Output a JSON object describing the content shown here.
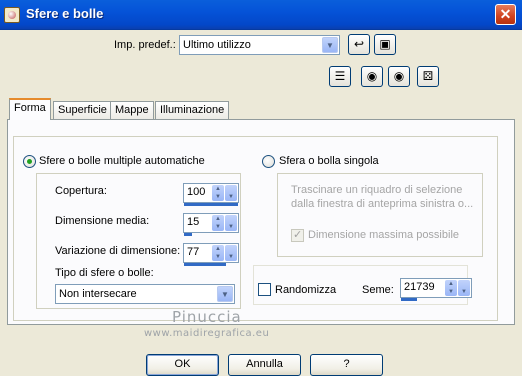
{
  "window": {
    "title": "Sfere e bolle",
    "close_glyph": "✕"
  },
  "preset": {
    "label": "Imp. predef.:",
    "value": "Ultimo utilizzo",
    "icons": [
      "reset-icon",
      "save-preset-icon"
    ]
  },
  "toolbar_icons": [
    "preview-toggle-icon",
    "eye-proof-icon",
    "eye-icon",
    "randomize-dice-icon"
  ],
  "tabs": [
    {
      "label": "Forma",
      "active": true
    },
    {
      "label": "Superficie",
      "active": false
    },
    {
      "label": "Mappe",
      "active": false
    },
    {
      "label": "Illuminazione",
      "active": false
    }
  ],
  "auto": {
    "radio_label": "Sfere o bolle multiple automatiche",
    "selected": true,
    "coverage": {
      "label": "Copertura:",
      "value": "100"
    },
    "avg_size": {
      "label": "Dimensione media:",
      "value": "15"
    },
    "size_var": {
      "label": "Variazione di dimensione:",
      "value": "77"
    },
    "type": {
      "label": "Tipo di sfere o bolle:",
      "value": "Non intersecare"
    }
  },
  "single": {
    "radio_label": "Sfera o bolla singola",
    "selected": false,
    "hint": "Trascinare un riquadro di selezione dalla finestra di anteprima sinistra o...",
    "max_size_label": "Dimensione massima possibile",
    "max_size_checked": true
  },
  "random": {
    "label": "Randomizza",
    "checked": false,
    "seed_label": "Seme:",
    "seed_value": "21739"
  },
  "buttons": {
    "ok": "OK",
    "cancel": "Annulla",
    "help": "?"
  },
  "watermark": {
    "name": "Pinuccia",
    "url": "www.maidiregrafica.eu"
  }
}
